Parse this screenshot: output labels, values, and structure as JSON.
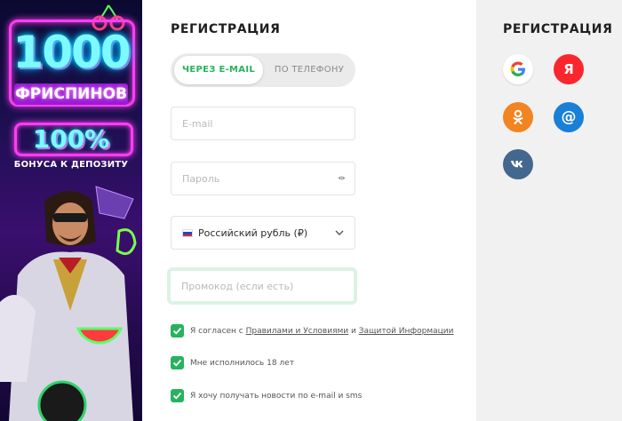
{
  "banner": {
    "big_number": "1000",
    "free_spins": "ФРИСПИНОВ",
    "percent": "100%",
    "bonus": "БОНУСА К ДЕПОЗИТУ"
  },
  "form": {
    "title": "РЕГИСТРАЦИЯ",
    "tabs": [
      {
        "label": "ЧЕРЕЗ E-MAIL",
        "active": true
      },
      {
        "label": "ПО ТЕЛЕФОНУ",
        "active": false
      }
    ],
    "email_placeholder": "E-mail",
    "password_placeholder": "Пароль",
    "currency_value": "Российский рубль (₽)",
    "promo_placeholder": "Промокод (если есть)",
    "checks": {
      "terms_prefix": "Я согласен с ",
      "terms_link": "Правилами и Условиями",
      "terms_and": " и ",
      "privacy_link": "Защитой Информации",
      "age": "Мне исполнилось 18 лет",
      "news": "Я хочу получать новости по e-mail и sms"
    }
  },
  "social": {
    "title": "РЕГИСТРАЦИЯ",
    "yandex_letter": "Я",
    "mail_symbol": "@",
    "icons": [
      "google-icon",
      "yandex-icon",
      "odnoklassniki-icon",
      "mailru-icon",
      "vk-icon"
    ]
  },
  "colors": {
    "accent_green": "#27b35e",
    "social_bg": "#f1f1f1",
    "yandex": "#f9262d",
    "ok": "#f28422",
    "mail": "#1a7fd6",
    "vk": "#44678d"
  }
}
